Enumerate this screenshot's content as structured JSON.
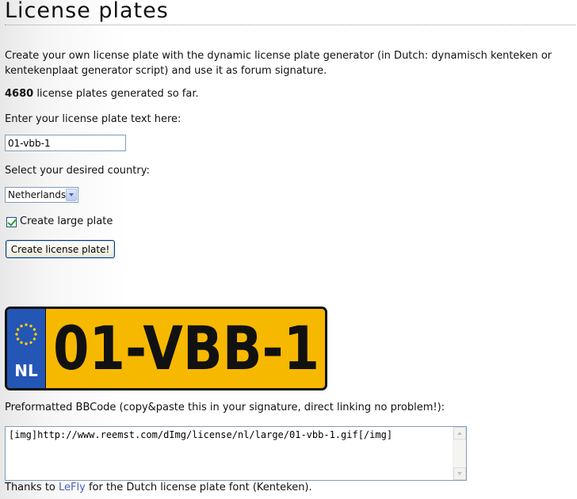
{
  "page": {
    "title": "License plates"
  },
  "intro": {
    "text": "Create your own license plate with the dynamic license plate generator (in Dutch: dynamisch kenteken or kentekenplaat generator script) and use it as forum signature."
  },
  "counter": {
    "count": "4680",
    "suffix": " license plates generated so far."
  },
  "form": {
    "text_label": "Enter your license plate text here:",
    "text_value": "01-vbb-1",
    "country_label": "Select your desired country:",
    "country_selected": "Netherlands",
    "large_plate_label": "Create large plate",
    "large_plate_checked": true,
    "submit_label": "Create license plate!"
  },
  "plate": {
    "country_code": "NL",
    "text": "01-VBB-1",
    "colors": {
      "background": "#f7b800",
      "band": "#2456b6",
      "stars": "#ffcc00"
    }
  },
  "bbcode": {
    "label": "Preformatted BBCode (copy&paste this in your signature, direct linking no problem!):",
    "value": "[img]http://www.reemst.com/dImg/license/nl/large/01-vbb-1.gif[/img]"
  },
  "credits": {
    "prefix": "Thanks to ",
    "link_text": "LeFly",
    "suffix": " for the Dutch license plate font (Kenteken)."
  }
}
